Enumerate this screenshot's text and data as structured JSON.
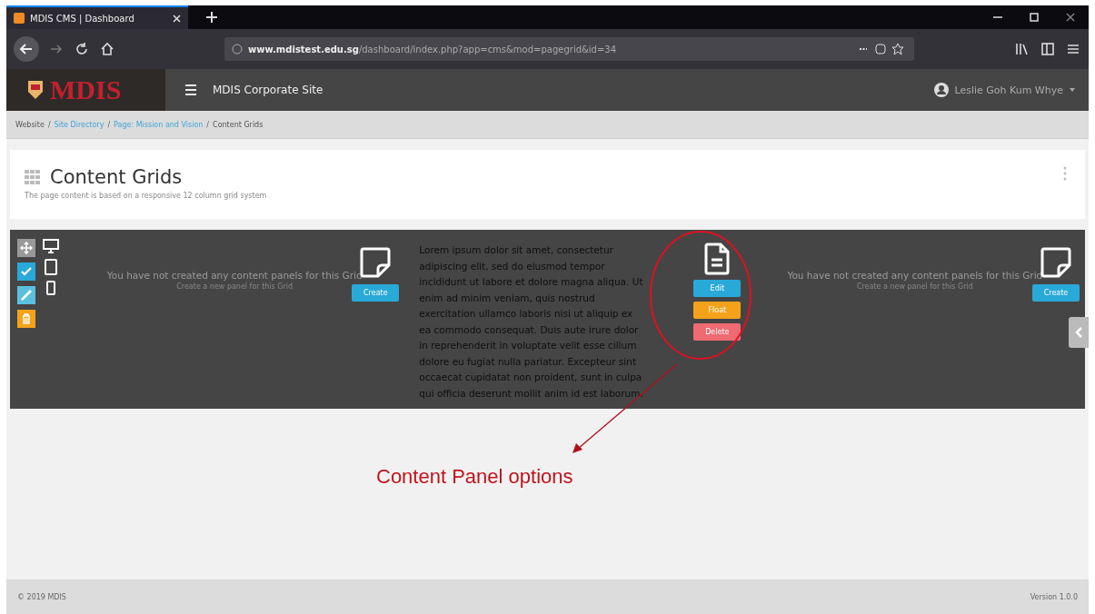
{
  "browser": {
    "tab_title": "MDIS CMS | Dashboard",
    "url_host": "www.mdistest.edu.sg",
    "url_path": "/dashboard/index.php?app=cms&mod=pagegrid&id=34"
  },
  "header": {
    "logo": "MDIS",
    "site": "MDIS Corporate Site",
    "user": "Leslie Goh Kum Whye"
  },
  "breadcrumb": {
    "separator": "/",
    "items": [
      {
        "label": "Website",
        "link": false
      },
      {
        "label": "Site Directory",
        "link": true
      },
      {
        "label": "Page: Mission and Vision",
        "link": true
      },
      {
        "label": "Content Grids",
        "link": false
      }
    ]
  },
  "page": {
    "title": "Content Grids",
    "subtitle": "The page content is based on a responsive 12 column grid system"
  },
  "grid": {
    "columns": [
      {
        "kind": "empty",
        "message": "You have not created any content panels for this Grid",
        "hint": "Create a new panel for this Grid",
        "button": "Create"
      },
      {
        "kind": "panel",
        "text": "Lorem ipsum dolor sit amet, consectetur adipiscing elit, sed do eiusmod tempor incididunt ut labore et dolore magna aliqua. Ut enim ad minim veniam, quis nostrud exercitation ullamco laboris nisi ut aliquip ex ea commodo consequat. Duis aute irure dolor in reprehenderit in voluptate velit esse cillum dolore eu fugiat nulla pariatur. Excepteur sint occaecat cupidatat non proident, sunt in culpa qui officia deserunt mollit anim id est laborum.",
        "actions": [
          {
            "label": "Edit",
            "color": "#29a9d8"
          },
          {
            "label": "Float",
            "color": "#f5a21b"
          },
          {
            "label": "Delete",
            "color": "#ef6b73"
          }
        ]
      },
      {
        "kind": "empty",
        "message": "You have not created any content panels for this Grid",
        "hint": "Create a new panel for this Grid",
        "button": "Create"
      }
    ]
  },
  "annotation": {
    "text": "Content Panel options"
  },
  "footer": {
    "copyright": "© 2019 MDIS",
    "version": "Version 1.0.0"
  }
}
